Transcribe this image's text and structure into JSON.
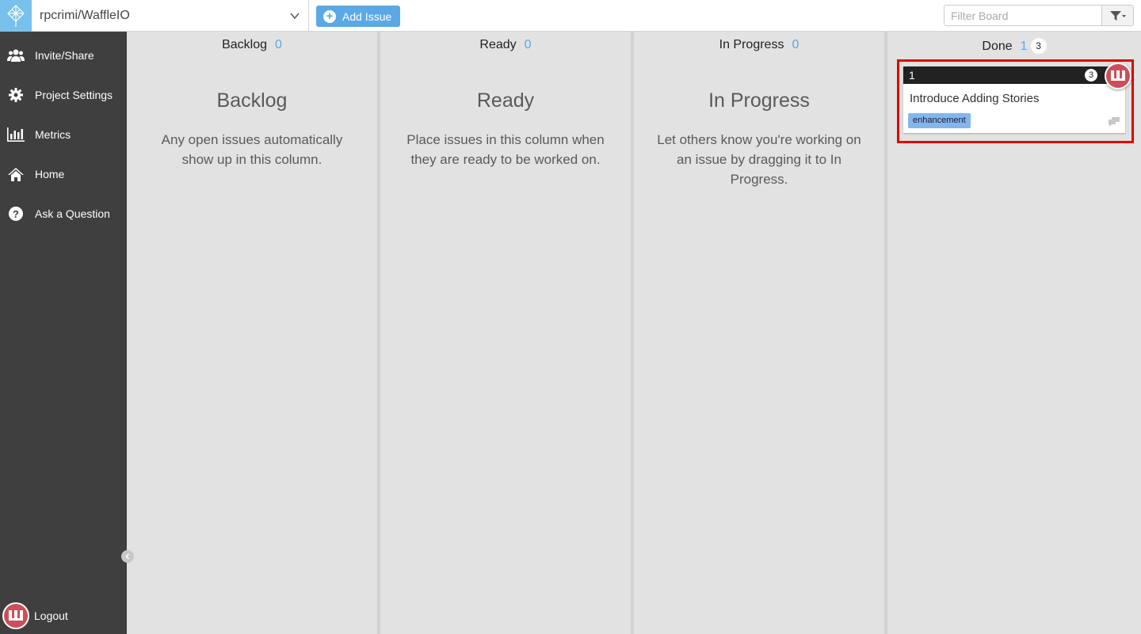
{
  "header": {
    "repo_name": "rpcrimi/WaffleIO",
    "add_issue_label": "Add Issue",
    "filter_placeholder": "Filter Board"
  },
  "sidebar": {
    "items": [
      {
        "label": "Invite/Share",
        "icon": "users-icon"
      },
      {
        "label": "Project Settings",
        "icon": "gear-icon"
      },
      {
        "label": "Metrics",
        "icon": "bar-chart-icon"
      },
      {
        "label": "Home",
        "icon": "home-icon"
      },
      {
        "label": "Ask a Question",
        "icon": "question-icon"
      }
    ],
    "logout_label": "Logout"
  },
  "columns": [
    {
      "name": "Backlog",
      "count": "0",
      "empty_title": "Backlog",
      "empty_desc": "Any open issues automatically show up in this column."
    },
    {
      "name": "Ready",
      "count": "0",
      "empty_title": "Ready",
      "empty_desc": "Place issues in this column when they are ready to be worked on."
    },
    {
      "name": "In Progress",
      "count": "0",
      "empty_title": "In Progress",
      "empty_desc": "Let others know you're working on an issue by dragging it to In Progress."
    },
    {
      "name": "Done",
      "count": "1",
      "badge": "3"
    }
  ],
  "card": {
    "number": "1",
    "comment_count": "3",
    "title": "Introduce Adding Stories",
    "label": "enhancement",
    "label_color": "#84b6eb"
  },
  "colors": {
    "sidebar_bg": "#3f3f3f",
    "accent": "#5aa9e6",
    "highlight": "#e00000"
  }
}
